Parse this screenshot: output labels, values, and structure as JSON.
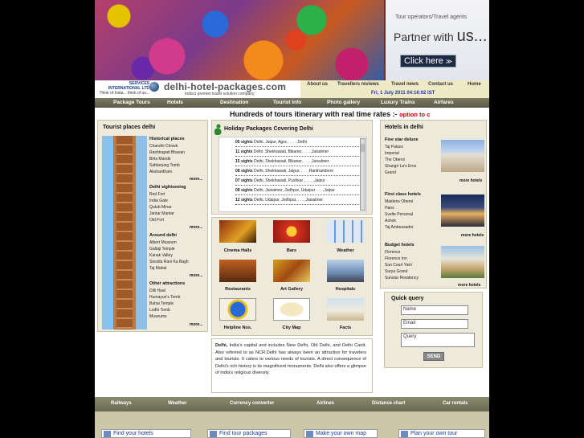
{
  "banner": {
    "partner_tag": "Tour operators/Travel agents",
    "partner_text": "Partner with",
    "partner_us": "us...",
    "click_label": "Click here",
    "click_arrow": "≫"
  },
  "header": {
    "services_line1": "SERVICES",
    "services_line2": "INTERNATIONAL LTD",
    "services_line3": "Think of India... think of us...",
    "site_name": "delhi-hotel-packages.com",
    "tagline": "India's premier travel solution company",
    "date": "Fri, 1 July 2011 04:16:02 IST",
    "top_links": [
      "About us",
      "Travellers reviews",
      "Travel news",
      "Contact us",
      "Home"
    ]
  },
  "main_menu": [
    "Package Tours",
    "Hotels",
    "Destination",
    "Tourist Info",
    "Photo gallery",
    "Luxury Trains",
    "Airfares"
  ],
  "ticker": {
    "text": "Hundreds of tours itinerary with real time rates :-",
    "option": "option to c"
  },
  "tourist_places": {
    "title": "Tourist places delhi",
    "sections": [
      {
        "heading": "Historical places",
        "items": [
          "Chandni Chowk",
          "Rashtrapati Bhavan",
          "Birla Mandir",
          "Safdarjung Tomb",
          "Akshardham"
        ],
        "more": "more..."
      },
      {
        "heading": "Delhi sightseeing",
        "items": [
          "Red Fort",
          "India Gate",
          "Qutub Minar",
          "Jantar Mantar",
          "Old Fort"
        ],
        "more": "more..."
      },
      {
        "heading": "Around delhi",
        "items": [
          "Albert Museum",
          "Galtaji Temple",
          "Kanak Valley",
          "Sisodia Rani Ka Bagh",
          "Taj Mahal"
        ],
        "more": "more..."
      },
      {
        "heading": "Other attractions",
        "items": [
          "Dilli Haat",
          "Humayun's Tomb",
          "Bahai Temple",
          "Lodhi Tomb",
          "Museums"
        ],
        "more": "more..."
      }
    ]
  },
  "holiday": {
    "title": "Holiday Packages Covering Delhi",
    "rows": [
      {
        "count": "05 sights",
        "route": "Delhi, Jaipur, Agra , . . . ,Delhi"
      },
      {
        "count": "11 sights",
        "route": "Delhi, Shekhawati, Bikaner, . . . ,Jaisalmer"
      },
      {
        "count": "15 sights",
        "route": "Delhi, Shekhawati, Bikaner, . . . ,Jaisalmer"
      },
      {
        "count": "08 sights",
        "route": "Delhi, Shekhawati, Jaipur, . . . ,Ranthambore"
      },
      {
        "count": "07 sights",
        "route": "Delhi, Shekhawati, Pushkar , . . . ,Jaipur"
      },
      {
        "count": "08 sights",
        "route": "Delhi, Jaisalmer, Jodhpur, Udaipur . . . ,Jaipur"
      },
      {
        "count": "12 sights",
        "route": "Delhi, Udaipur, Jodhpur, . . . ,Jaisalmer"
      },
      {
        "count": "",
        "route": ""
      }
    ]
  },
  "icon_grid": [
    "Cinema Halls",
    "Bars",
    "Weather",
    "Restaurants",
    "Art Gallery",
    "Hospitals",
    "Helpline Nos.",
    "City Map",
    "Facts"
  ],
  "description": {
    "bold": "Delhi,",
    "text": " India's capital and includes New Delhi, Old Delhi, and Delhi Cantt. Also referred to as NCR.Delhi has always been an attraction for travelers and tourists. It caters to various needs of tourists. A direct consequence of Delhi's rich history is its magnificent monuments. Delhi also offers a glimpse of India's religious diversity."
  },
  "hotels": {
    "title": "Hotels in delhi",
    "groups": [
      {
        "heading": "Five star deluxe",
        "items": [
          "Taj Palace",
          "Imperial",
          "The Oberoi",
          "Shangri La's Eros",
          "Grand"
        ],
        "more": "more hotels"
      },
      {
        "heading": "First class hotels",
        "items": [
          "Maidens Oberoi",
          "Hans",
          "Svelte Personal",
          "Ashok",
          "Taj Ambassador"
        ],
        "more": "more hotels"
      },
      {
        "heading": "Budget hotels",
        "items": [
          "Florence",
          "Florence Inn",
          "Sun Court Yatri",
          "Surya Grand",
          "Sunstar Residency"
        ],
        "more": "more hotels"
      }
    ]
  },
  "quick_query": {
    "title": "Quick query",
    "name_ph": "Name",
    "email_ph": "Email",
    "query_ph": "Query",
    "send": "SEND"
  },
  "bottom_menu": [
    "Railways",
    "Weather",
    "Currency converter",
    "Airlines",
    "Distance chart",
    "Car rentals"
  ],
  "bottom_links": [
    "Find your hotels",
    "Find tour packages",
    "Make your own map",
    "Plan your own tour"
  ]
}
